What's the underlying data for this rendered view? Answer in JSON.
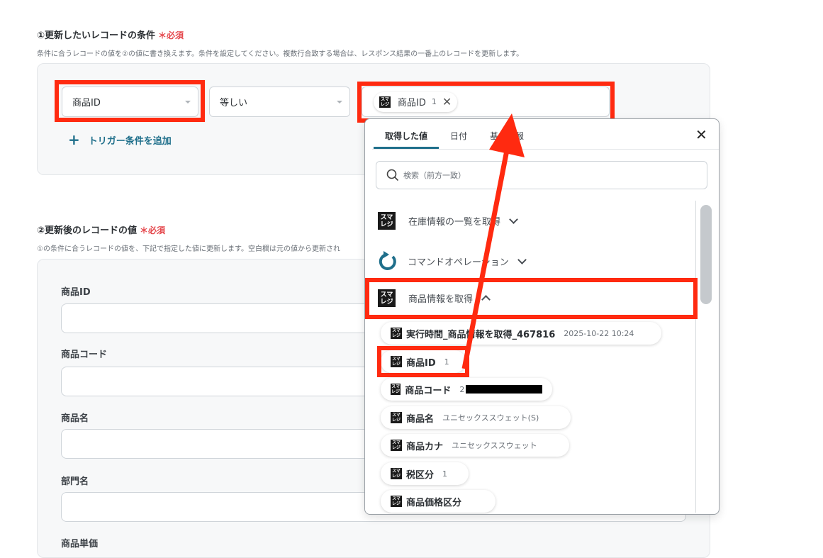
{
  "section1": {
    "title": "①更新したいレコードの条件",
    "required": "＊必須",
    "description": "条件に合うレコードの値を②の値に書き換えます。条件を設定してください。複数行合致する場合は、レスポンス結果の一番上のレコードを更新します。",
    "condition": {
      "field_value": "商品ID",
      "operator_value": "等しい",
      "token_name": "商品ID",
      "token_value": "1"
    },
    "add_trigger_label": "トリガー条件を追加"
  },
  "section2": {
    "title": "②更新後のレコードの値",
    "required": "＊必須",
    "description": "①の条件に合うレコードの値を、下記で指定した値に更新します。空白欄は元の値から更新され",
    "fields": [
      {
        "label": "商品ID"
      },
      {
        "label": "商品コード"
      },
      {
        "label": "商品名"
      },
      {
        "label": "部門名"
      },
      {
        "label": "商品単価"
      }
    ]
  },
  "popup": {
    "tabs": [
      "取得した値",
      "日付",
      "基本情報"
    ],
    "active_tab": 0,
    "search_placeholder": "検索（前方一致）",
    "groups": [
      {
        "label": "在庫情報の一覧を取得",
        "icon": "smaregi-logo",
        "expanded": false
      },
      {
        "label": "コマンドオペレーション",
        "icon": "refresh-icon",
        "expanded": false
      },
      {
        "label": "商品情報を取得",
        "icon": "smaregi-logo",
        "expanded": true
      }
    ],
    "items": [
      {
        "name": "実行時間_商品情報を取得_467816",
        "value": "2025-10-22 10:24"
      },
      {
        "name": "商品ID",
        "value": "1"
      },
      {
        "name": "商品コード",
        "value": "2"
      },
      {
        "name": "商品名",
        "value": "ユニセックススウェット(S)"
      },
      {
        "name": "商品カナ",
        "value": "ユニセックススウェット"
      },
      {
        "name": "税区分",
        "value": "1"
      },
      {
        "name": "商品価格区分",
        "value": ""
      }
    ],
    "logo_text": "スマレジ"
  },
  "colors": {
    "highlight": "#ff2a10",
    "accent": "#1f6f8b",
    "required": "#e5484d"
  }
}
